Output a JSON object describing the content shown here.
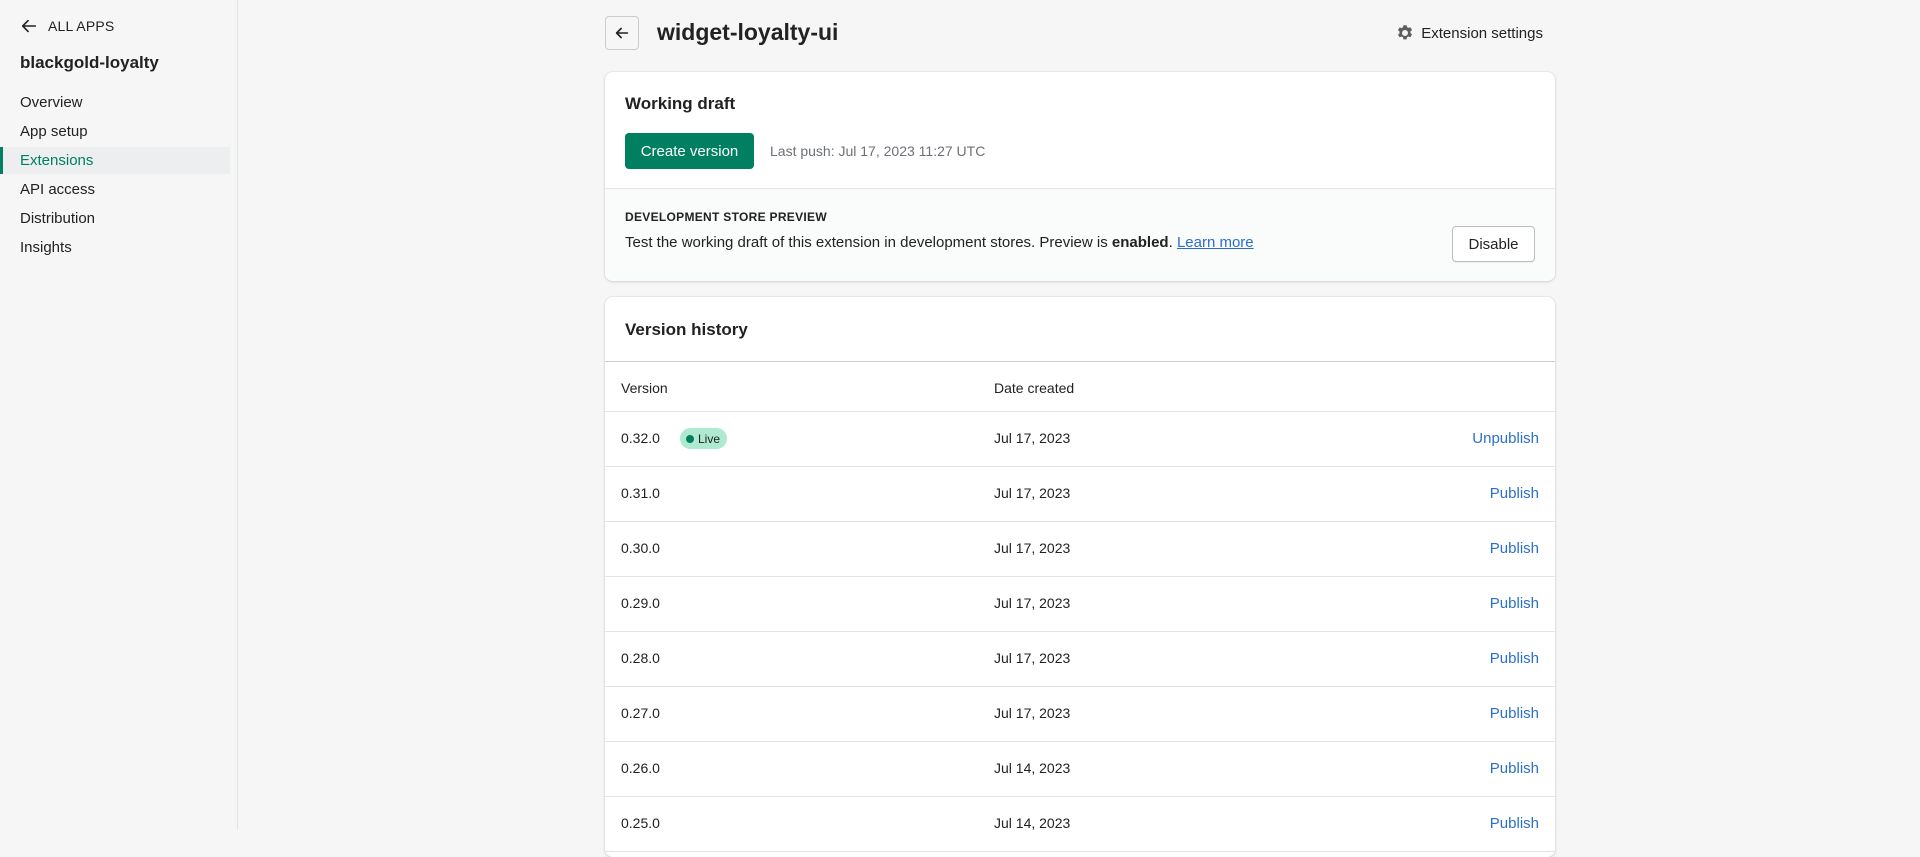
{
  "sidebar": {
    "back_label": "ALL APPS",
    "app_name": "blackgold-loyalty",
    "items": [
      {
        "label": "Overview",
        "active": false
      },
      {
        "label": "App setup",
        "active": false
      },
      {
        "label": "Extensions",
        "active": true
      },
      {
        "label": "API access",
        "active": false
      },
      {
        "label": "Distribution",
        "active": false
      },
      {
        "label": "Insights",
        "active": false
      }
    ]
  },
  "header": {
    "title": "widget-loyalty-ui",
    "settings_label": "Extension settings"
  },
  "draft": {
    "title": "Working draft",
    "create_label": "Create version",
    "last_push": "Last push: Jul 17, 2023 11:27 UTC",
    "preview": {
      "heading": "DEVELOPMENT STORE PREVIEW",
      "text_before": "Test the working draft of this extension in development stores. Preview is ",
      "status": "enabled",
      "text_after": ".",
      "learn_more": "Learn more",
      "disable_label": "Disable"
    }
  },
  "history": {
    "title": "Version history",
    "columns": {
      "version": "Version",
      "date": "Date created"
    },
    "rows": [
      {
        "version": "0.32.0",
        "badge": "Live",
        "date": "Jul 17, 2023",
        "action": "Unpublish"
      },
      {
        "version": "0.31.0",
        "badge": "",
        "date": "Jul 17, 2023",
        "action": "Publish"
      },
      {
        "version": "0.30.0",
        "badge": "",
        "date": "Jul 17, 2023",
        "action": "Publish"
      },
      {
        "version": "0.29.0",
        "badge": "",
        "date": "Jul 17, 2023",
        "action": "Publish"
      },
      {
        "version": "0.28.0",
        "badge": "",
        "date": "Jul 17, 2023",
        "action": "Publish"
      },
      {
        "version": "0.27.0",
        "badge": "",
        "date": "Jul 17, 2023",
        "action": "Publish"
      },
      {
        "version": "0.26.0",
        "badge": "",
        "date": "Jul 14, 2023",
        "action": "Publish"
      },
      {
        "version": "0.25.0",
        "badge": "",
        "date": "Jul 14, 2023",
        "action": "Publish"
      }
    ]
  },
  "colors": {
    "accent": "#008060",
    "link": "#2c6ecb",
    "live_badge": "#aee9d1"
  }
}
